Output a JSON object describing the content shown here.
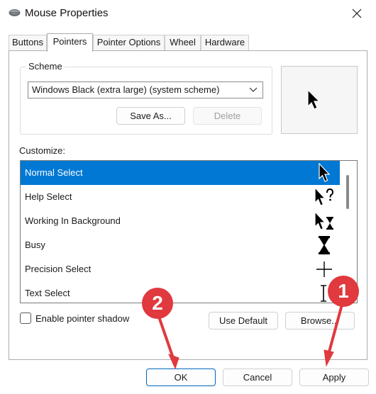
{
  "window": {
    "title": "Mouse Properties"
  },
  "tabs": [
    {
      "label": "Buttons"
    },
    {
      "label": "Pointers"
    },
    {
      "label": "Pointer Options"
    },
    {
      "label": "Wheel"
    },
    {
      "label": "Hardware"
    }
  ],
  "active_tab": "Pointers",
  "scheme": {
    "label": "Scheme",
    "selected": "Windows Black (extra large) (system scheme)",
    "save_as_label": "Save As...",
    "delete_label": "Delete"
  },
  "customize": {
    "label": "Customize:",
    "items": [
      {
        "label": "Normal Select",
        "icon": "arrow-cursor-icon",
        "selected": true
      },
      {
        "label": "Help Select",
        "icon": "help-cursor-icon"
      },
      {
        "label": "Working In Background",
        "icon": "busy-arrow-cursor-icon"
      },
      {
        "label": "Busy",
        "icon": "hourglass-cursor-icon"
      },
      {
        "label": "Precision Select",
        "icon": "crosshair-cursor-icon"
      },
      {
        "label": "Text Select",
        "icon": "text-beam-cursor-icon"
      }
    ]
  },
  "pointer_shadow": {
    "label": "Enable pointer shadow",
    "checked": false
  },
  "buttons": {
    "use_default": "Use Default",
    "browse": "Browse...",
    "ok": "OK",
    "cancel": "Cancel",
    "apply": "Apply"
  },
  "annotations": {
    "badge_1": "1",
    "badge_2": "2",
    "color": "#e0393e"
  },
  "colors": {
    "selection": "#0078d4",
    "accent_border": "#0067c0"
  }
}
